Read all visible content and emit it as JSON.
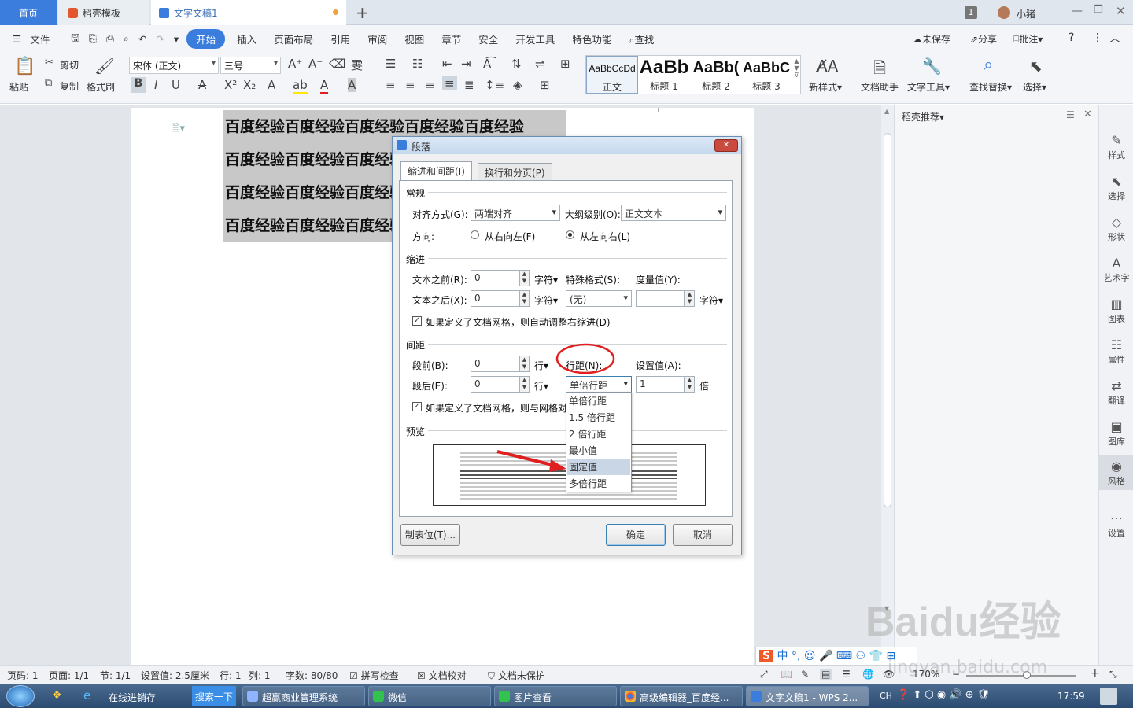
{
  "tabs": {
    "home": "首页",
    "template": "稻壳模板",
    "document": "文字文稿1",
    "user_badge": "1",
    "user_name": "小猪"
  },
  "menu": {
    "file": "文件",
    "items": [
      "开始",
      "插入",
      "页面布局",
      "引用",
      "审阅",
      "视图",
      "章节",
      "安全",
      "开发工具",
      "特色功能"
    ],
    "search": "查找",
    "unsaved": "未保存",
    "share": "分享",
    "comment": "批注"
  },
  "ribbon": {
    "paste": "粘贴",
    "cut": "剪切",
    "copy": "复制",
    "format_painter": "格式刷",
    "font_name": "宋体 (正文)",
    "font_size": "三号",
    "styles": [
      {
        "preview": "AaBbCcDd",
        "name": "正文"
      },
      {
        "preview": "AaBb",
        "name": "标题 1"
      },
      {
        "preview": "AaBb(",
        "name": "标题 2"
      },
      {
        "preview": "AaBbC",
        "name": "标题 3"
      }
    ],
    "new_style": "新样式",
    "doc_assistant": "文档助手",
    "text_tools": "文字工具",
    "find_replace": "查找替换",
    "select": "选择"
  },
  "document": {
    "lines": [
      "百度经验百度经验百度经验百度经验百度经验",
      "百度经验百度经验百度经验百度经验百度经验",
      "百度经验百度经验百度经验百度经验百度经验",
      "百度经验百度经验百度经验百度经验百度经验"
    ]
  },
  "right_pane": {
    "title": "稻壳推荐"
  },
  "sidebar": [
    "样式",
    "选择",
    "形状",
    "艺术字",
    "图表",
    "属性",
    "翻译",
    "图库",
    "风格",
    "设置"
  ],
  "dialog": {
    "title": "段落",
    "tab_indent": "缩进和间距(I)",
    "tab_break": "换行和分页(P)",
    "general": "常规",
    "align_label": "对齐方式(G):",
    "align_value": "两端对齐",
    "outline_label": "大纲级别(O):",
    "outline_value": "正文文本",
    "direction_label": "方向:",
    "rtl": "从右向左(F)",
    "ltr": "从左向右(L)",
    "indent": "缩进",
    "before_text_label": "文本之前(R):",
    "before_text_value": "0",
    "after_text_label": "文本之后(X):",
    "after_text_value": "0",
    "unit_char": "字符",
    "special_label": "特殊格式(S):",
    "special_value": "(无)",
    "measure_label": "度量值(Y):",
    "measure_value": "",
    "auto_indent_check": "如果定义了文档网格，则自动调整右缩进(D)",
    "spacing": "间距",
    "before_label": "段前(B):",
    "before_value": "0",
    "after_label": "段后(E):",
    "after_value": "0",
    "unit_line": "行",
    "line_spacing_label": "行距(N):",
    "line_spacing_value": "单倍行距",
    "set_value_label": "设置值(A):",
    "set_value": "1",
    "unit_times": "倍",
    "grid_check": "如果定义了文档网格，则与网格对",
    "preview": "预览",
    "tab_stops": "制表位(T)...",
    "ok": "确定",
    "cancel": "取消",
    "line_spacing_options": [
      "单倍行距",
      "1.5 倍行距",
      "2 倍行距",
      "最小值",
      "固定值",
      "多倍行距"
    ],
    "highlighted_option": "固定值"
  },
  "statusbar": {
    "page_code": "页码: 1",
    "pages": "页面: 1/1",
    "section": "节: 1/1",
    "setting": "设置值: 2.5厘米",
    "row": "行: 1",
    "col": "列: 1",
    "words": "字数: 80/80",
    "spell": "拼写检查",
    "proof": "文档校对",
    "protect": "文档未保护",
    "zoom": "170%"
  },
  "taskbar": {
    "items": [
      "在线进销存",
      "搜索一下",
      "超赢商业管理系统",
      "微信",
      "图片查看",
      "高级编辑器_百度经...",
      "文字文稿1 - WPS 2..."
    ],
    "lang": "CH",
    "time": "17:59"
  },
  "watermark": "Baidu经验",
  "watermark_url": "jingyan.baidu.com",
  "colors": {
    "accent": "#3b7ddd",
    "dialog_title": "#c6d8ee",
    "selection": "#c8c8c8",
    "annotation": "#e02020"
  }
}
